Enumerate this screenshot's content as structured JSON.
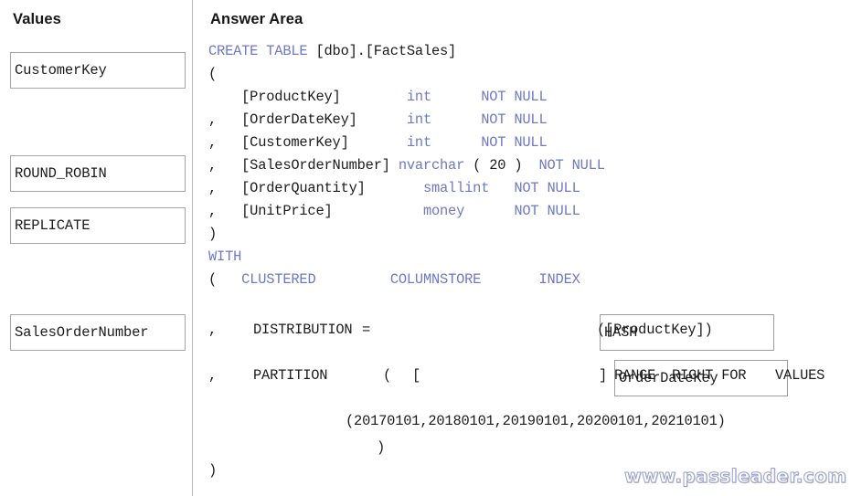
{
  "panels": {
    "values_heading": "Values",
    "answer_heading": "Answer Area"
  },
  "values_panel": {
    "tiles": [
      {
        "label": "CustomerKey"
      },
      {
        "label": "ROUND_ROBIN"
      },
      {
        "label": "REPLICATE"
      },
      {
        "label": "SalesOrderNumber"
      }
    ]
  },
  "code": {
    "lines": [
      {
        "segments": [
          {
            "t": "CREATE TABLE",
            "c": "kw"
          },
          {
            "t": " [dbo].[FactSales]",
            "c": "pl"
          }
        ]
      },
      {
        "segments": [
          {
            "t": "(",
            "c": "pl"
          }
        ]
      },
      {
        "segments": [
          {
            "t": "    [ProductKey]        ",
            "c": "pl"
          },
          {
            "t": "int",
            "c": "kw"
          },
          {
            "t": "      ",
            "c": "pl"
          },
          {
            "t": "NOT NULL",
            "c": "kw"
          }
        ]
      },
      {
        "segments": [
          {
            "t": ",   [OrderDateKey]      ",
            "c": "pl"
          },
          {
            "t": "int",
            "c": "kw"
          },
          {
            "t": "      ",
            "c": "pl"
          },
          {
            "t": "NOT NULL",
            "c": "kw"
          }
        ]
      },
      {
        "segments": [
          {
            "t": ",   [CustomerKey]       ",
            "c": "pl"
          },
          {
            "t": "int",
            "c": "kw"
          },
          {
            "t": "      ",
            "c": "pl"
          },
          {
            "t": "NOT NULL",
            "c": "kw"
          }
        ]
      },
      {
        "segments": [
          {
            "t": ",   [SalesOrderNumber] ",
            "c": "pl"
          },
          {
            "t": "nvarchar",
            "c": "kw"
          },
          {
            "t": " ( 20 )  ",
            "c": "pl"
          },
          {
            "t": "NOT NULL",
            "c": "kw"
          }
        ]
      },
      {
        "segments": [
          {
            "t": ",   [OrderQuantity]       ",
            "c": "pl"
          },
          {
            "t": "smallint",
            "c": "kw"
          },
          {
            "t": "   ",
            "c": "pl"
          },
          {
            "t": "NOT NULL",
            "c": "kw"
          }
        ]
      },
      {
        "segments": [
          {
            "t": ",   [UnitPrice]           ",
            "c": "pl"
          },
          {
            "t": "money",
            "c": "kw"
          },
          {
            "t": "      ",
            "c": "pl"
          },
          {
            "t": "NOT NULL",
            "c": "kw"
          }
        ]
      },
      {
        "segments": [
          {
            "t": ")",
            "c": "pl"
          }
        ]
      },
      {
        "segments": [
          {
            "t": "WITH",
            "c": "kw"
          }
        ]
      },
      {
        "segments": [
          {
            "t": "(   ",
            "c": "pl"
          },
          {
            "t": "CLUSTERED",
            "c": "kw"
          },
          {
            "t": "         ",
            "c": "pl"
          },
          {
            "t": "COLUMNSTORE",
            "c": "kw"
          },
          {
            "t": "       ",
            "c": "pl"
          },
          {
            "t": "INDEX",
            "c": "kw"
          }
        ]
      }
    ],
    "distribution_line": {
      "prefix_comma": ",",
      "keyword": "DISTRIBUTION",
      "equals": "=",
      "suffix": "([ProductKey])"
    },
    "partition_line": {
      "prefix_comma": ",",
      "keyword": "PARTITION",
      "open_paren": "(",
      "open_bracket": "[",
      "close_bracket": "]",
      "range_kw": "RANGE",
      "right_for": "RIGHT FOR",
      "values_kw": "VALUES"
    },
    "partition_values": "(20170101,20180101,20190101,20200101,20210101)",
    "inner_close_paren": ")",
    "outer_close_paren": ")"
  },
  "answers": {
    "distribution_value": "HASH",
    "partition_value": "OrderDateKey"
  },
  "watermark": {
    "text": "www.passleader.com"
  },
  "colors": {
    "keyword": "#6f78c4",
    "plain": "#1b1b1b",
    "tile_border": "#a6a6a6",
    "divider": "#b9b9b9",
    "background": "#ffffff"
  }
}
